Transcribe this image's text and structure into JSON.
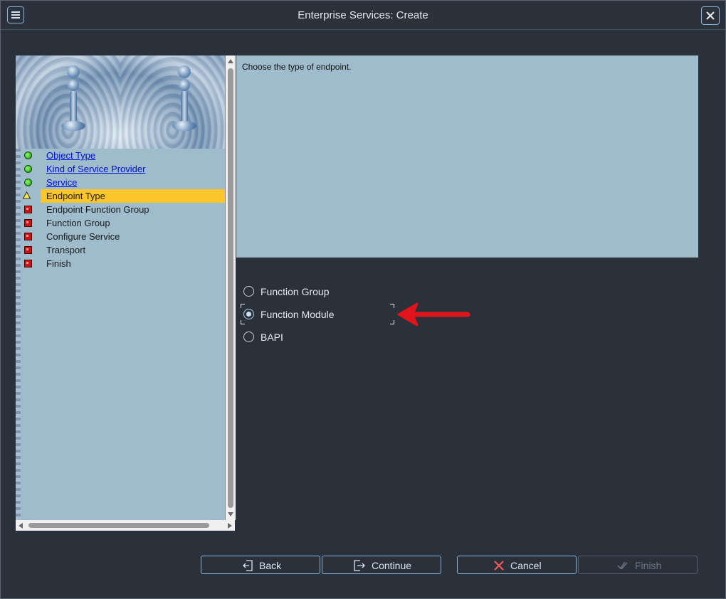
{
  "window": {
    "title": "Enterprise Services: Create"
  },
  "roadmap": {
    "steps": [
      {
        "label": "Object Type",
        "status": "done"
      },
      {
        "label": "Kind of Service Provider",
        "status": "done"
      },
      {
        "label": "Service",
        "status": "done"
      },
      {
        "label": "Endpoint Type",
        "status": "active"
      },
      {
        "label": "Endpoint Function Group",
        "status": "pending"
      },
      {
        "label": "Function Group",
        "status": "pending"
      },
      {
        "label": "Configure Service",
        "status": "pending"
      },
      {
        "label": "Transport",
        "status": "pending"
      },
      {
        "label": "Finish",
        "status": "pending"
      }
    ]
  },
  "main": {
    "instruction": "Choose the type of endpoint.",
    "options": [
      {
        "label": "Function Group",
        "selected": false
      },
      {
        "label": "Function Module",
        "selected": true
      },
      {
        "label": "BAPI",
        "selected": false
      }
    ]
  },
  "footer": {
    "back_label": "Back",
    "continue_label": "Continue",
    "cancel_label": "Cancel",
    "finish_label": "Finish"
  },
  "icons": {
    "menu": "hamburger-icon",
    "close": "close-icon",
    "back": "back-icon",
    "continue": "continue-icon",
    "cancel": "cancel-x-icon",
    "finish": "finish-check-icon"
  },
  "colors": {
    "accent": "#8ab4d8",
    "active_step": "#ffc52c",
    "link": "#0010d6",
    "annotation_arrow": "#e0141b"
  }
}
